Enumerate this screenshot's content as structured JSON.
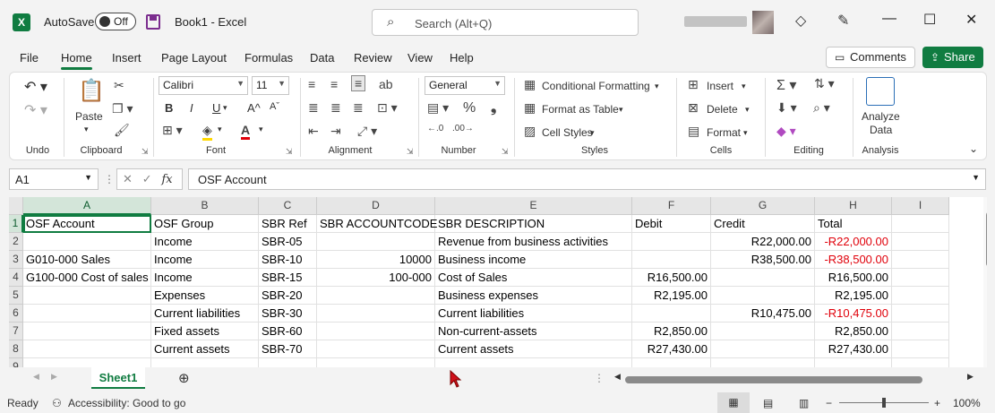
{
  "app": {
    "autosave_label": "AutoSave",
    "autosave_state": "Off",
    "doc_title": "Book1  -  Excel",
    "search_placeholder": "Search (Alt+Q)",
    "logo_letter": "X"
  },
  "menu": {
    "tabs": [
      "File",
      "Home",
      "Insert",
      "Page Layout",
      "Formulas",
      "Data",
      "Review",
      "View",
      "Help"
    ],
    "comments_label": "Comments",
    "share_label": "Share"
  },
  "ribbon": {
    "groups": [
      "Undo",
      "Clipboard",
      "Font",
      "Alignment",
      "Number",
      "Styles",
      "Cells",
      "Editing",
      "Analysis"
    ],
    "paste_label": "Paste",
    "font_name": "Calibri",
    "font_size": "11",
    "number_format": "General",
    "styles": {
      "conditional": "Conditional Formatting",
      "format_table": "Format as Table",
      "cell_styles": "Cell Styles"
    },
    "cells": {
      "insert": "Insert",
      "delete": "Delete",
      "format": "Format"
    },
    "analyze_line1": "Analyze",
    "analyze_line2": "Data",
    "bold": "B",
    "italic": "I",
    "underline": "U"
  },
  "formula_bar": {
    "name_box": "A1",
    "fx": "fx",
    "content": "OSF Account"
  },
  "sheet": {
    "columns": [
      "A",
      "B",
      "C",
      "D",
      "E",
      "F",
      "G",
      "H",
      "I"
    ],
    "rows": [
      "1",
      "2",
      "3",
      "4",
      "5",
      "6",
      "7",
      "8",
      "9"
    ],
    "cells": [
      [
        "OSF Account",
        "OSF Group",
        "SBR Ref",
        "SBR ACCOUNTCODE",
        "SBR DESCRIPTION",
        "Debit",
        "Credit",
        "Total",
        ""
      ],
      [
        "",
        "Income",
        "SBR-05",
        "",
        "Revenue from business activities",
        "",
        "R22,000.00",
        "-R22,000.00",
        ""
      ],
      [
        "G010-000 Sales",
        "Income",
        "SBR-10",
        "10000",
        "Business income",
        "",
        "R38,500.00",
        "-R38,500.00",
        ""
      ],
      [
        "G100-000 Cost of sales",
        "Income",
        "SBR-15",
        "100-000",
        "Cost of Sales",
        "R16,500.00",
        "",
        "R16,500.00",
        ""
      ],
      [
        "",
        "Expenses",
        "SBR-20",
        "",
        "Business expenses",
        "R2,195.00",
        "",
        "R2,195.00",
        ""
      ],
      [
        "",
        "Current liabilities",
        "SBR-30",
        "",
        "Current liabilities",
        "",
        "R10,475.00",
        "-R10,475.00",
        ""
      ],
      [
        "",
        "Fixed assets",
        "SBR-60",
        "",
        "Non-current-assets",
        "R2,850.00",
        "",
        "R2,850.00",
        ""
      ],
      [
        "",
        "Current assets",
        "SBR-70",
        "",
        "Current assets",
        "R27,430.00",
        "",
        "R27,430.00",
        ""
      ],
      [
        "",
        "",
        "",
        "",
        "",
        "",
        "",
        "",
        ""
      ]
    ],
    "tab_name": "Sheet1"
  },
  "status": {
    "ready": "Ready",
    "accessibility": "Accessibility: Good to go",
    "zoom": "100%"
  },
  "colors": {
    "accent": "#107c41",
    "negative": "#e0000a"
  }
}
